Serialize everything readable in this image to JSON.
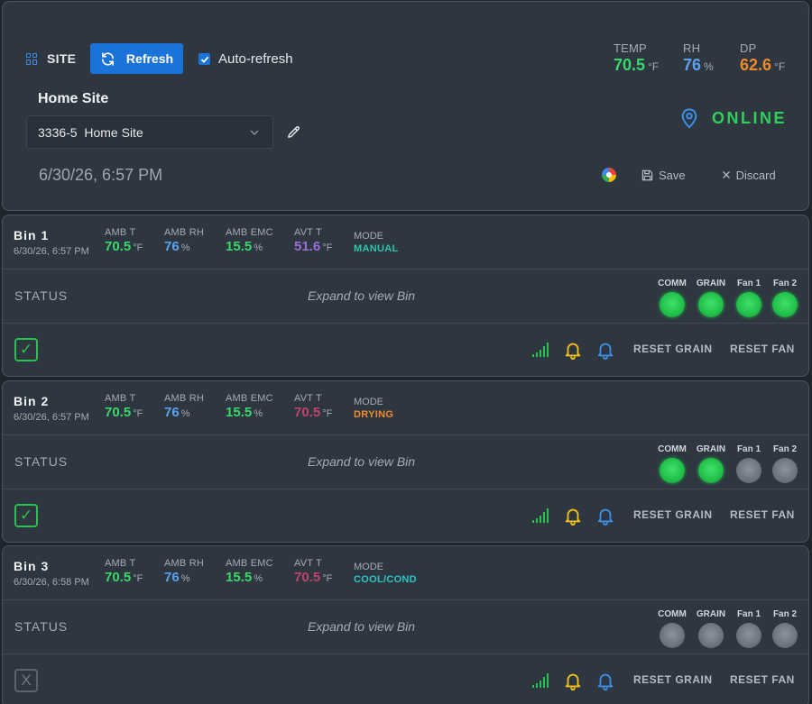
{
  "header": {
    "site_tab": "SITE",
    "refresh_label": "Refresh",
    "auto_refresh_label": "Auto-refresh",
    "auto_refresh_checked": true,
    "site_title": "Home Site",
    "site_select_value": "3336-5  Home Site",
    "datetime": "6/30/26, 6:57 PM",
    "status": "ONLINE",
    "save_label": "Save",
    "discard_label": "Discard",
    "metrics": [
      {
        "label": "TEMP",
        "value": "70.5",
        "unit": "°F",
        "color": "#3ad86a"
      },
      {
        "label": "RH",
        "value": "76",
        "unit": "%",
        "color": "#5aa2f0"
      },
      {
        "label": "DP",
        "value": "62.6",
        "unit": "°F",
        "color": "#f08a2c"
      }
    ]
  },
  "labels": {
    "amb_t": "AMB T",
    "amb_rh": "AMB RH",
    "amb_emc": "AMB EMC",
    "avt_t": "AVT T",
    "mode": "MODE",
    "status": "STATUS",
    "expand": "Expand to view Bin",
    "reset_grain": "RESET GRAIN",
    "reset_fan": "RESET FAN",
    "ind_comm": "COMM",
    "ind_grain": "GRAIN",
    "ind_fan1": "Fan 1",
    "ind_fan2": "Fan 2",
    "unit_f": "°F",
    "unit_pct": "%"
  },
  "bins": [
    {
      "name": "Bin 1",
      "time": "6/30/26, 6:57 PM",
      "amb_t": "70.5",
      "amb_rh": "76",
      "amb_emc": "15.5",
      "avt_t": "51.6",
      "avt_color": "#9a6fd6",
      "mode": "MANUAL",
      "mode_color": "#2ec5a8",
      "comm": true,
      "grain": true,
      "fan1": true,
      "fan2": true,
      "check": "✓",
      "check_ok": true
    },
    {
      "name": "Bin 2",
      "time": "6/30/26, 6:57 PM",
      "amb_t": "70.5",
      "amb_rh": "76",
      "amb_emc": "15.5",
      "avt_t": "70.5",
      "avt_color": "#c0436e",
      "mode": "DRYING",
      "mode_color": "#f08a2c",
      "comm": true,
      "grain": true,
      "fan1": false,
      "fan2": false,
      "check": "✓",
      "check_ok": true
    },
    {
      "name": "Bin 3",
      "time": "6/30/26, 6:58 PM",
      "amb_t": "70.5",
      "amb_rh": "76",
      "amb_emc": "15.5",
      "avt_t": "70.5",
      "avt_color": "#c0436e",
      "mode": "COOL/COND",
      "mode_color": "#2ec5c4",
      "comm": false,
      "grain": false,
      "fan1": false,
      "fan2": false,
      "check": "X",
      "check_ok": false
    }
  ]
}
